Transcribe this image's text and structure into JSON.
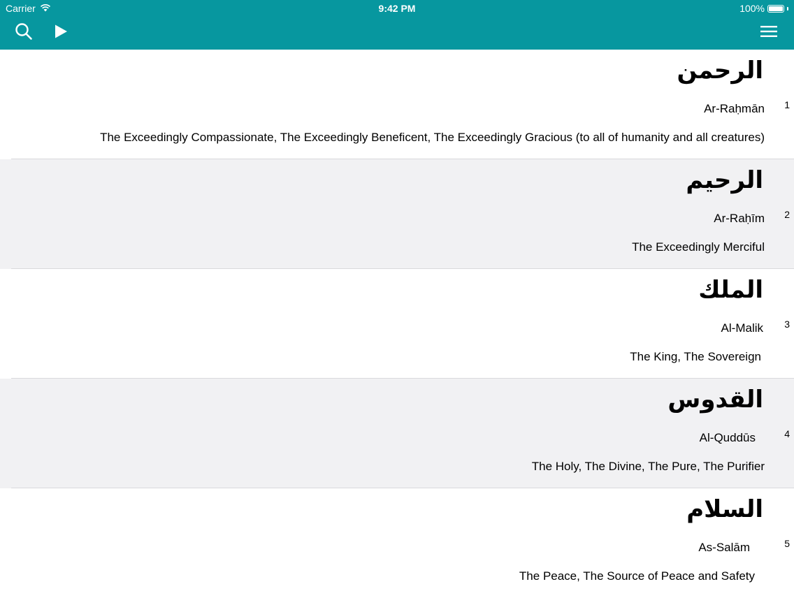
{
  "status_bar": {
    "carrier": "Carrier",
    "time": "9:42 PM",
    "battery": "100%",
    "battery_level": 1.0
  },
  "nav_bar": {
    "background": "#07979f",
    "left_icons": [
      "search-icon",
      "play-icon"
    ],
    "right_icons": [
      "hamburger-menu-icon"
    ]
  },
  "names": [
    {
      "index": "1",
      "arabic": "الرحمن",
      "transliteration": "Ar-Raḥmān",
      "meaning": "The Exceedingly Compassionate, The Exceedingly Beneficent, The Exceedingly Gracious (to all of humanity and all creatures)"
    },
    {
      "index": "2",
      "arabic": "الرحيم",
      "transliteration": "Ar-Raḥīm",
      "meaning": "The Exceedingly Merciful"
    },
    {
      "index": "3",
      "arabic": "الملك",
      "transliteration": "Al-Malik",
      "meaning": "The King, The Sovereign"
    },
    {
      "index": "4",
      "arabic": "القدوس",
      "transliteration": "Al-Quddūs",
      "meaning": "The Holy, The Divine, The Pure, The Purifier"
    },
    {
      "index": "5",
      "arabic": "السلام",
      "transliteration": "As-Salām",
      "meaning": "The Peace, The Source of Peace and Safety"
    }
  ]
}
